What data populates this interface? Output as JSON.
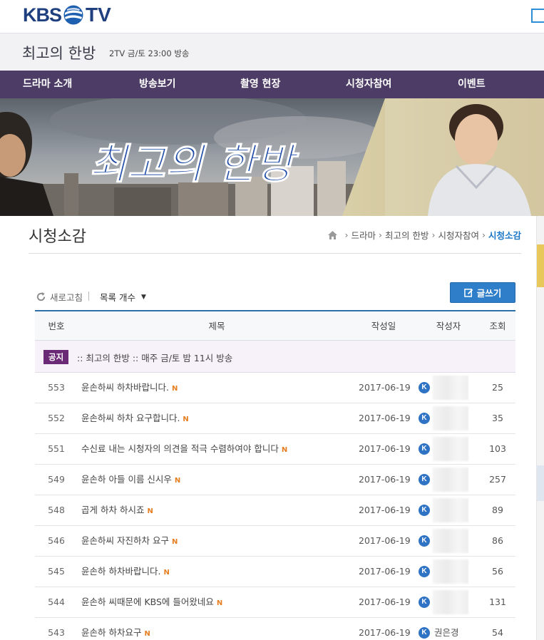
{
  "logo": {
    "left": "KBS",
    "right": "TV"
  },
  "program": {
    "title": "최고의 한방",
    "schedule": "2TV 금/토 23:00 방송"
  },
  "nav": [
    {
      "label": "드라마 소개"
    },
    {
      "label": "방송보기"
    },
    {
      "label": "촬영 현장"
    },
    {
      "label": "시청자참여"
    },
    {
      "label": "이벤트"
    }
  ],
  "banner": {
    "logo_text": "최고의 한방"
  },
  "page": {
    "title": "시청소감",
    "breadcrumb": [
      "드라마",
      "최고의 한방",
      "시청자참여",
      "시청소감"
    ]
  },
  "toolbar": {
    "refresh": "새로고침",
    "list_count": "목록 개수",
    "write": "글쓰기"
  },
  "table": {
    "headers": {
      "no": "번호",
      "title": "제목",
      "date": "작성일",
      "author": "작성자",
      "views": "조회"
    },
    "notice": {
      "badge": "공지",
      "text": ":: 최고의 한방 :: 매주 금/토 밤 11시 방송"
    },
    "rows": [
      {
        "no": "553",
        "title": "윤손하씨 하차바랍니다.",
        "new": "N",
        "date": "2017-06-19",
        "badge": "K",
        "author": "",
        "views": "25"
      },
      {
        "no": "552",
        "title": "윤손하씨 하차 요구합니다.",
        "new": "N",
        "date": "2017-06-19",
        "badge": "K",
        "author": "",
        "views": "35"
      },
      {
        "no": "551",
        "title": "수신료 내는 시청자의 의견을 적극 수렴하여야 합니다",
        "new": "N",
        "date": "2017-06-19",
        "badge": "K",
        "author": "",
        "views": "103"
      },
      {
        "no": "549",
        "title": "윤손하 아들 이름 신시우",
        "new": "N",
        "date": "2017-06-19",
        "badge": "K",
        "author": "",
        "views": "257"
      },
      {
        "no": "548",
        "title": "곱게 하차 하시죠",
        "new": "N",
        "date": "2017-06-19",
        "badge": "K",
        "author": "",
        "views": "89"
      },
      {
        "no": "546",
        "title": "윤손하씨 자진하차 요구",
        "new": "N",
        "date": "2017-06-19",
        "badge": "K",
        "author": "",
        "views": "86"
      },
      {
        "no": "545",
        "title": "윤손하 하차바랍니다.",
        "new": "N",
        "date": "2017-06-19",
        "badge": "K",
        "author": "",
        "views": "56"
      },
      {
        "no": "544",
        "title": "윤손하 씨때문에 KBS에 들어왔네요",
        "new": "N",
        "date": "2017-06-19",
        "badge": "K",
        "author": "",
        "views": "131"
      },
      {
        "no": "543",
        "title": "윤손하 하차요구",
        "new": "N",
        "date": "2017-06-19",
        "badge": "K",
        "author": "권은경",
        "views": "54"
      }
    ]
  },
  "colors": {
    "nav_bg": "#4d3d66",
    "accent_blue": "#2f7ec9",
    "notice_badge": "#6b2a75",
    "new_marker": "#e67e22"
  }
}
